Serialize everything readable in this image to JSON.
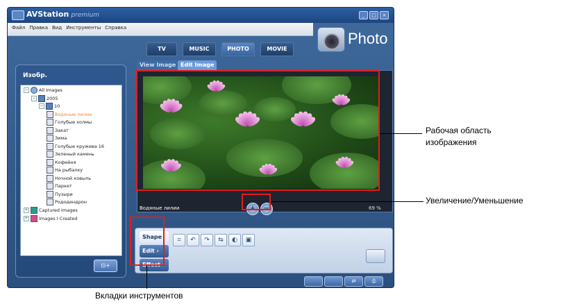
{
  "app": {
    "title": "AVStation",
    "edition": "premium",
    "window_controls": [
      "_",
      "□",
      "×"
    ],
    "menu": [
      "Файл",
      "Правка",
      "Вид",
      "Инструменты",
      "Справка"
    ],
    "section_title": "Photo"
  },
  "nav_tabs": [
    "TV",
    "MUSIC",
    "PHOTO",
    "MOVIE"
  ],
  "active_nav_tab": "PHOTO",
  "sidebar": {
    "title": "Изобр.",
    "tree": [
      {
        "label": "All Images",
        "level": 0,
        "toggle": "⊟",
        "icon": "globe"
      },
      {
        "label": "2005",
        "level": 1,
        "toggle": "⊟",
        "icon": "folder"
      },
      {
        "label": "10",
        "level": 2,
        "toggle": "⊟",
        "icon": "folder"
      },
      {
        "label": "Водяные лилии",
        "level": 3,
        "icon": "image",
        "selected": true
      },
      {
        "label": "Голубые холмы",
        "level": 3,
        "icon": "image"
      },
      {
        "label": "Закат",
        "level": 3,
        "icon": "image"
      },
      {
        "label": "Зима",
        "level": 3,
        "icon": "image"
      },
      {
        "label": "Голубые кружева 16",
        "level": 3,
        "icon": "image"
      },
      {
        "label": "Зеленый камень",
        "level": 3,
        "icon": "image"
      },
      {
        "label": "Кофейня",
        "level": 3,
        "icon": "image"
      },
      {
        "label": "На рыбалку",
        "level": 3,
        "icon": "image"
      },
      {
        "label": "Ночной ковыль",
        "level": 3,
        "icon": "image"
      },
      {
        "label": "Паркет",
        "level": 3,
        "icon": "image"
      },
      {
        "label": "Пузыри",
        "level": 3,
        "icon": "image"
      },
      {
        "label": "Рододендрон",
        "level": 3,
        "icon": "image"
      },
      {
        "label": "Captured Images",
        "level": 0,
        "toggle": "⊞",
        "icon": "captured"
      },
      {
        "label": "Images I Created",
        "level": 0,
        "toggle": "⊞",
        "icon": "created"
      }
    ],
    "new_folder_label": "⊡+"
  },
  "viewer": {
    "tabs": [
      "View Image",
      "Edit Image"
    ],
    "active_tab": "Edit Image",
    "caption": "Водяные лилии",
    "zoom_in": "+",
    "zoom_out": "−",
    "zoom_percent": "69 %"
  },
  "tools": {
    "tabs": [
      "Shape",
      "Edit",
      "Effect"
    ],
    "active_tab": "Shape",
    "tab_arrows": [
      "",
      "›",
      "›"
    ],
    "shape_icons": [
      "crop-icon",
      "rotate-left-icon",
      "rotate-right-icon",
      "flip-icon",
      "redeye-icon",
      "resize-icon"
    ],
    "shape_glyphs": [
      "⌗",
      "↶",
      "↷",
      "⇆",
      "◐",
      "▣"
    ]
  },
  "bottom_buttons": [
    "",
    "",
    "⇄",
    "⎙"
  ],
  "annotations": {
    "work_area": "Рабочая область изображения",
    "zoom": "Увеличение/Уменьшение",
    "tool_tabs": "Вкладки инструментов"
  },
  "colors": {
    "annotation_box": "#e51b1b",
    "selected_item": "#f08a24",
    "app_blue": "#2b4f7e"
  }
}
